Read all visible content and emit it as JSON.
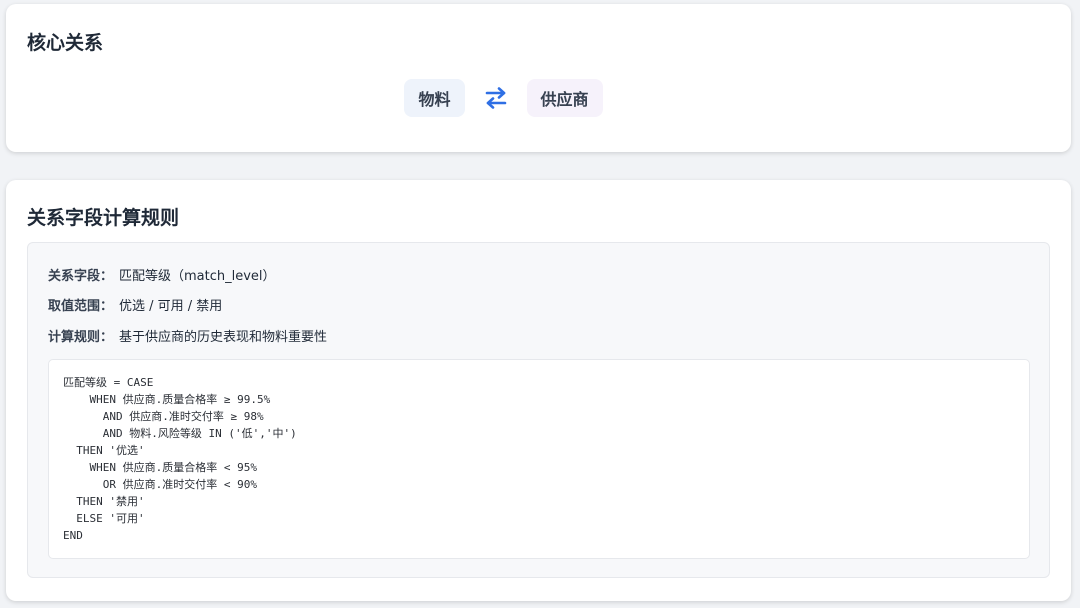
{
  "core": {
    "title": "核心关系",
    "entity_a": "物料",
    "entity_b": "供应商",
    "swap_icon": "swap-arrows-icon",
    "accent": "#2f6fe4"
  },
  "rules": {
    "title": "关系字段计算规则",
    "field_label": "关系字段：",
    "field_value": "匹配等级（match_level）",
    "range_label": "取值范围：",
    "range_value": "优选 / 可用 / 禁用",
    "rule_label": "计算规则：",
    "rule_value": "基于供应商的历史表现和物料重要性",
    "code": [
      "匹配等级 = CASE",
      "    WHEN 供应商.质量合格率 ≥ 99.5%",
      "      AND 供应商.准时交付率 ≥ 98%",
      "      AND 物料.风险等级 IN ('低','中')",
      "  THEN '优选'",
      "    WHEN 供应商.质量合格率 < 95%",
      "      OR 供应商.准时交付率 < 90%",
      "  THEN '禁用'",
      "  ELSE '可用'",
      "END"
    ]
  }
}
